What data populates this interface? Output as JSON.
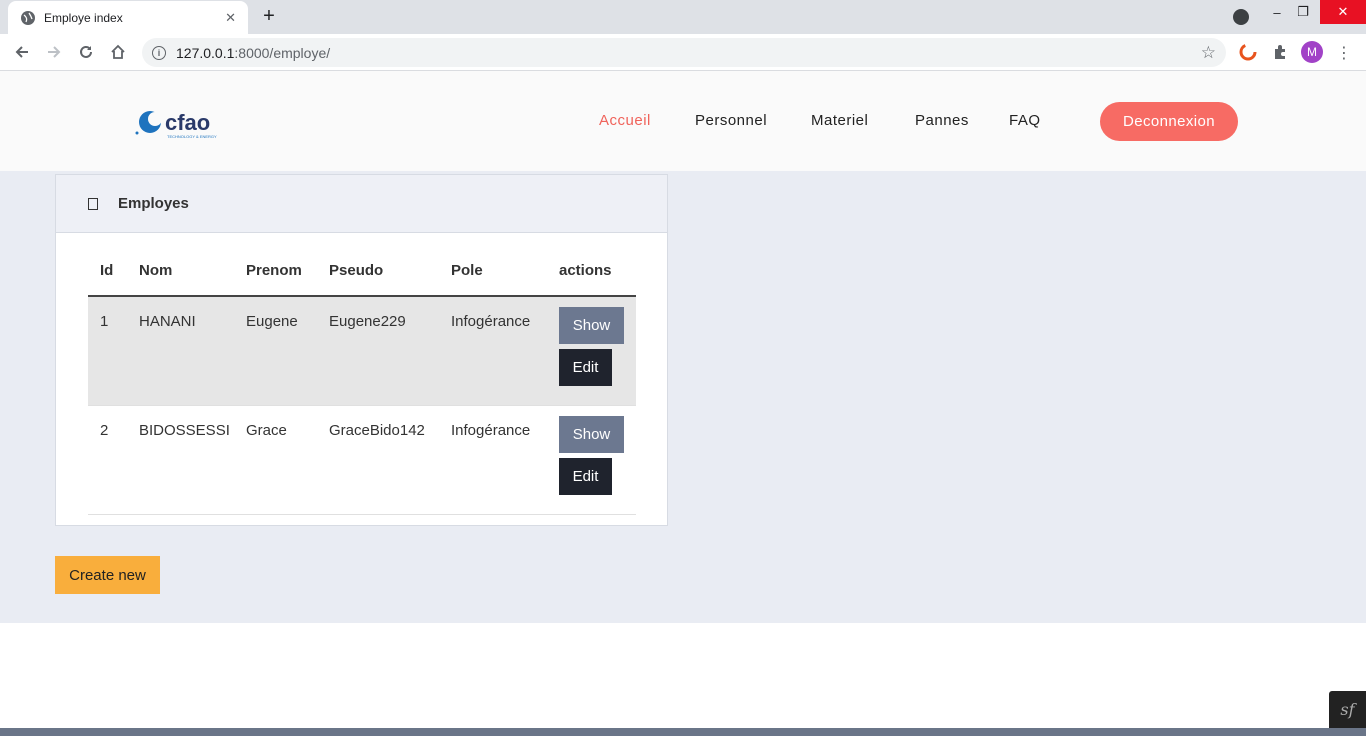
{
  "browser": {
    "tab_title": "Employe index",
    "tab_close": "✕",
    "new_tab": "+",
    "url_host": "127.0.0.1",
    "url_rest": ":8000/employe/",
    "avatar_letter": "M",
    "window_minimize": "–",
    "window_restore": "❐",
    "window_close": "✕"
  },
  "header": {
    "logo_text": "cfao",
    "logo_tagline": "TECHNOLOGY & ENERGY",
    "nav": {
      "home": "Accueil",
      "staff": "Personnel",
      "hardware": "Materiel",
      "faults": "Pannes",
      "faq": "FAQ"
    },
    "logout": "Deconnexion"
  },
  "card": {
    "title": "Employes",
    "columns": {
      "id": "Id",
      "nom": "Nom",
      "prenom": "Prenom",
      "pseudo": "Pseudo",
      "pole": "Pole",
      "actions": "actions"
    },
    "rows": [
      {
        "id": "1",
        "nom": "HANANI",
        "prenom": "Eugene",
        "pseudo": "Eugene229",
        "pole": "Infogérance",
        "show": "Show",
        "edit": "Edit"
      },
      {
        "id": "2",
        "nom": "BIDOSSESSI",
        "prenom": "Grace",
        "pseudo": "GraceBido142",
        "pole": "Infogérance",
        "show": "Show",
        "edit": "Edit"
      }
    ]
  },
  "create_new": "Create new",
  "symfony_toolbar": "sf",
  "colors": {
    "accent": "#f76b64",
    "active_nav": "#f0635b",
    "show_button": "#6c7890",
    "edit_button": "#1f232d",
    "create_button": "#f9ae3c",
    "content_bg": "#e9ecf3"
  }
}
